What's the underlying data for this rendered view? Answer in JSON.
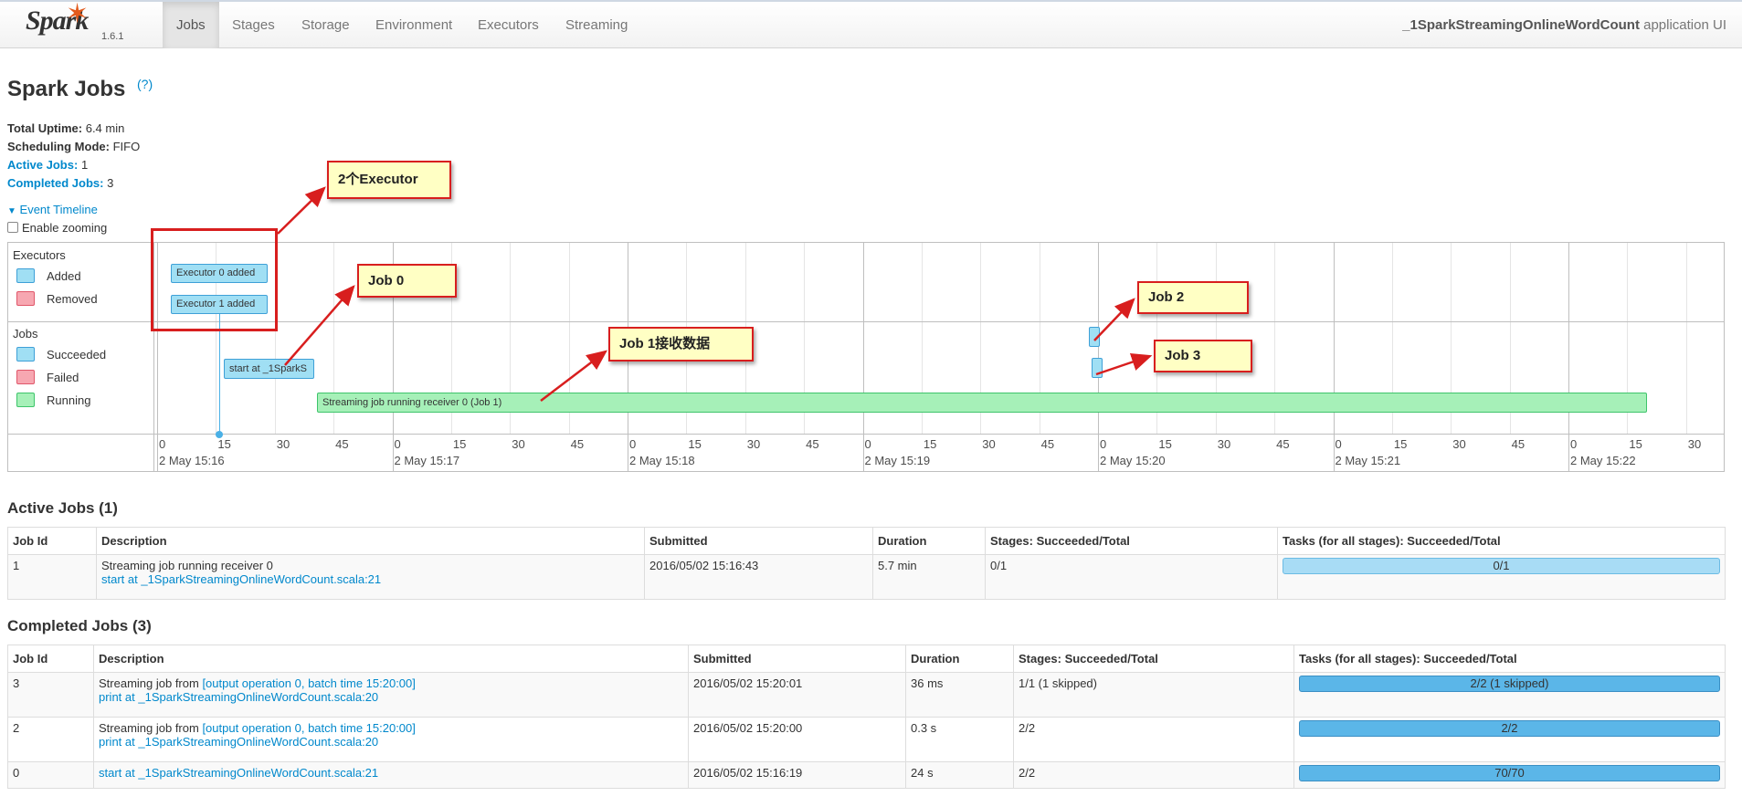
{
  "navbar": {
    "logo": "Spark",
    "version": "1.6.1",
    "tabs": [
      "Jobs",
      "Stages",
      "Storage",
      "Environment",
      "Executors",
      "Streaming"
    ],
    "active_tab": "Jobs",
    "app_name": "_1SparkStreamingOnlineWordCount",
    "app_suffix": "application UI"
  },
  "page": {
    "title": "Spark Jobs",
    "help": "(?)"
  },
  "summary": {
    "uptime_label": "Total Uptime:",
    "uptime_value": "6.4 min",
    "mode_label": "Scheduling Mode:",
    "mode_value": "FIFO",
    "active_label": "Active Jobs:",
    "active_value": "1",
    "completed_label": "Completed Jobs:",
    "completed_value": "3"
  },
  "timeline": {
    "toggle_label": "Event Timeline",
    "zoom_label": "Enable zooming",
    "executors_group": "Executors",
    "legend_added": "Added",
    "legend_removed": "Removed",
    "jobs_group": "Jobs",
    "legend_succeeded": "Succeeded",
    "legend_failed": "Failed",
    "legend_running": "Running",
    "executor0": "Executor 0 added",
    "executor1": "Executor 1 added",
    "job0": "start at _1SparkS",
    "running_job": "Streaming job running receiver 0 (Job 1)",
    "ticks": [
      "0",
      "15",
      "30",
      "45",
      "0",
      "15",
      "30",
      "45",
      "0",
      "15",
      "30",
      "45",
      "0",
      "15",
      "30",
      "45",
      "0",
      "15",
      "30",
      "45",
      "0",
      "15",
      "30",
      "45",
      "0",
      "15",
      "30"
    ],
    "majors": [
      "2 May 15:16",
      "2 May 15:17",
      "2 May 15:18",
      "2 May 15:19",
      "2 May 15:20",
      "2 May 15:21",
      "2 May 15:22"
    ]
  },
  "annotations": {
    "a1": "2个Executor",
    "a2": "Job 0",
    "a3": "Job 1接收数据",
    "a4": "Job 2",
    "a5": "Job 3"
  },
  "active_jobs": {
    "heading": "Active Jobs (1)",
    "headers": [
      "Job Id",
      "Description",
      "Submitted",
      "Duration",
      "Stages: Succeeded/Total",
      "Tasks (for all stages): Succeeded/Total"
    ],
    "rows": [
      {
        "id": "1",
        "desc": "Streaming job running receiver 0",
        "link": "start at _1SparkStreamingOnlineWordCount.scala:21",
        "submitted": "2016/05/02 15:16:43",
        "duration": "5.7 min",
        "stages": "0/1",
        "tasks": "0/1",
        "progress": 0
      }
    ]
  },
  "completed_jobs": {
    "heading": "Completed Jobs (3)",
    "headers": [
      "Job Id",
      "Description",
      "Submitted",
      "Duration",
      "Stages: Succeeded/Total",
      "Tasks (for all stages): Succeeded/Total"
    ],
    "rows": [
      {
        "id": "3",
        "prefix": "Streaming job from ",
        "batch": "[output operation 0, batch time 15:20:00]",
        "link": "print at _1SparkStreamingOnlineWordCount.scala:20",
        "submitted": "2016/05/02 15:20:01",
        "duration": "36 ms",
        "stages": "1/1 (1 skipped)",
        "tasks": "2/2 (1 skipped)",
        "progress": 1
      },
      {
        "id": "2",
        "prefix": "Streaming job from ",
        "batch": "[output operation 0, batch time 15:20:00]",
        "link": "print at _1SparkStreamingOnlineWordCount.scala:20",
        "submitted": "2016/05/02 15:20:00",
        "duration": "0.3 s",
        "stages": "2/2",
        "tasks": "2/2",
        "progress": 1
      },
      {
        "id": "0",
        "prefix": "",
        "batch": "",
        "link": "start at _1SparkStreamingOnlineWordCount.scala:21",
        "submitted": "2016/05/02 15:16:19",
        "duration": "24 s",
        "stages": "2/2",
        "tasks": "70/70",
        "progress": 1
      }
    ]
  },
  "colors": {
    "link": "#0088cc",
    "annotation_border": "#d81e1e",
    "annotation_fill": "#ffffc4",
    "succeeded": "#a0dff4",
    "running": "#a6f0b8",
    "failed": "#f7a7b1"
  }
}
